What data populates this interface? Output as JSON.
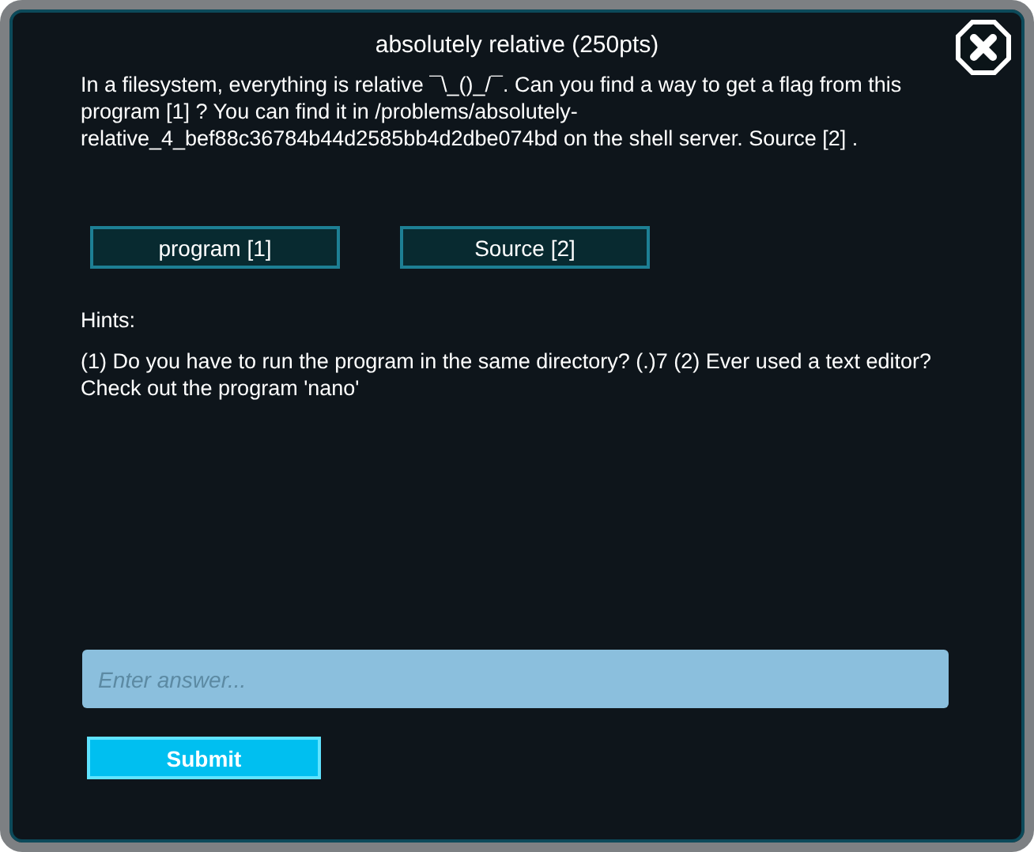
{
  "dialog": {
    "title": "absolutely relative (250pts)",
    "description": "In a filesystem, everything is relative ¯\\_()_/¯. Can you find a way to get a flag from this program [1] ? You can find it in /problems/absolutely-relative_4_bef88c36784b44d2585bb4d2dbe074bd on the shell server. Source [2] .",
    "links": [
      "program [1]",
      "Source [2]"
    ],
    "hints_label": "Hints:",
    "hints": "(1) Do you have to run the program in the same directory? (.)7 (2) Ever used a text editor? Check out the program 'nano'",
    "answer": {
      "placeholder": "Enter answer..."
    },
    "submit": "Submit"
  }
}
